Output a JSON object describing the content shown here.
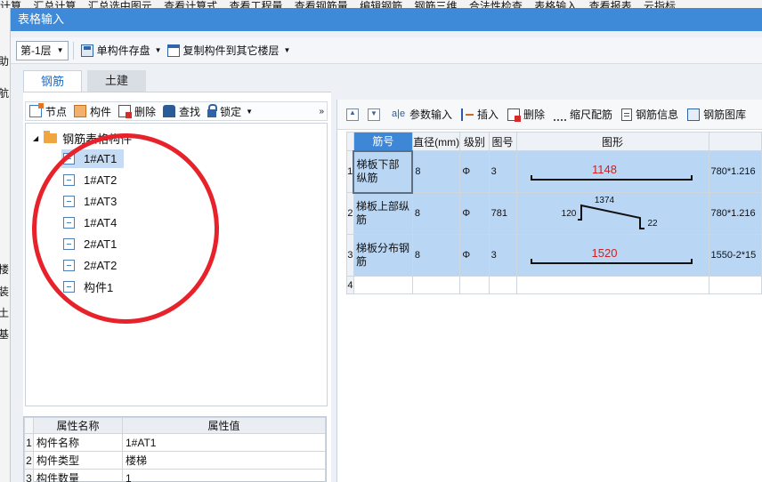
{
  "background": {
    "menu_items": [
      "计算",
      "汇总计算",
      "汇总选中图元",
      "查看计算式",
      "查看工程量",
      "查看钢筋量",
      "编辑钢筋",
      "钢筋三维",
      "合法性检查",
      "表格输入",
      "查看报表",
      "云指标"
    ],
    "left_fragments": [
      "助",
      "航",
      "楼",
      "装",
      "土",
      "基"
    ]
  },
  "window": {
    "title": "表格输入"
  },
  "toolbar": {
    "floor_select": "第-1层",
    "save_component": "单构件存盘",
    "copy_component": "复制构件到其它楼层"
  },
  "tabs": [
    {
      "label": "钢筋",
      "active": true
    },
    {
      "label": "土建",
      "active": false
    }
  ],
  "left_toolbar": {
    "node": "节点",
    "component": "构件",
    "delete": "删除",
    "find": "查找",
    "lock": "锁定",
    "more": "»"
  },
  "tree": {
    "root": "钢筋表格构件",
    "items": [
      {
        "label": "1#AT1",
        "selected": true
      },
      {
        "label": "1#AT2",
        "selected": false
      },
      {
        "label": "1#AT3",
        "selected": false
      },
      {
        "label": "1#AT4",
        "selected": false
      },
      {
        "label": "2#AT1",
        "selected": false
      },
      {
        "label": "2#AT2",
        "selected": false
      },
      {
        "label": "构件1",
        "selected": false
      }
    ]
  },
  "annotation": {
    "color": "#e8222a"
  },
  "properties": {
    "headers": [
      "属性名称",
      "属性值"
    ],
    "rows": [
      {
        "num": "1",
        "name": "构件名称",
        "value": "1#AT1"
      },
      {
        "num": "2",
        "name": "构件类型",
        "value": "楼梯"
      },
      {
        "num": "3",
        "name": "构件数量",
        "value": "1"
      }
    ]
  },
  "right_toolbar": {
    "param_input": "参数输入",
    "insert": "插入",
    "delete": "删除",
    "scale_config": "缩尺配筋",
    "rebar_info": "钢筋信息",
    "rebar_library": "钢筋图库"
  },
  "rebar_table": {
    "headers": {
      "name": "筋号",
      "diameter": "直径(mm)",
      "grade": "级别",
      "shape_no": "图号",
      "shape": "图形",
      "formula": ""
    },
    "rows": [
      {
        "num": "1",
        "name": "梯板下部纵筋",
        "diameter": "8",
        "grade": "Φ",
        "shape_no": "3",
        "shape_type": "straight",
        "length_label": "1148",
        "formula": "780*1.216"
      },
      {
        "num": "2",
        "name": "梯板上部纵筋",
        "diameter": "8",
        "grade": "Φ",
        "shape_no": "781",
        "shape_type": "bent",
        "left_hook": "120",
        "length_label": "1374",
        "right_hook": "22",
        "formula": "780*1.216"
      },
      {
        "num": "3",
        "name": "梯板分布钢筋",
        "diameter": "8",
        "grade": "Φ",
        "shape_no": "3",
        "shape_type": "straight",
        "length_label": "1520",
        "formula": "1550-2*15"
      },
      {
        "num": "4",
        "name": "",
        "diameter": "",
        "grade": "",
        "shape_no": "",
        "shape_type": "none",
        "length_label": "",
        "formula": ""
      }
    ]
  }
}
